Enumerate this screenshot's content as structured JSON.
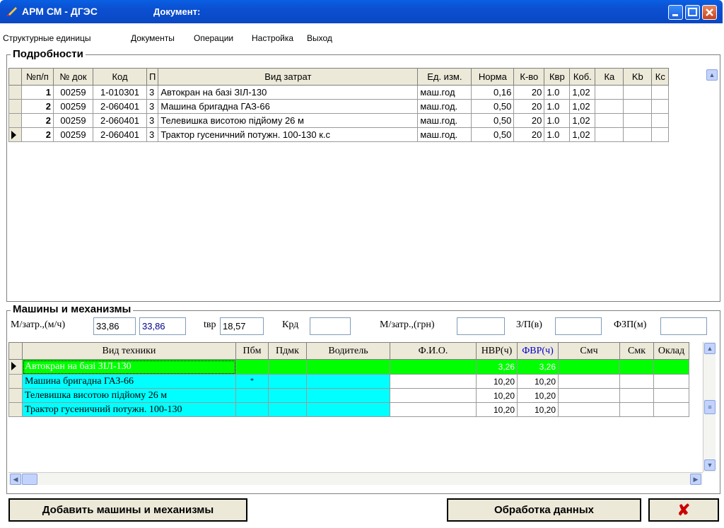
{
  "window": {
    "app_title": "АРМ СМ - ДГЭС",
    "doc_label": "Документ:"
  },
  "menu": [
    "Структурные единицы",
    "Документы",
    "Операции",
    "Настройка",
    "Выход"
  ],
  "details": {
    "label": "Подробности",
    "columns": [
      "№п/п",
      "№ док",
      "Код",
      "П",
      "Вид затрат",
      "Ед. изм.",
      "Норма",
      "К-во",
      "Квр",
      "Коб.",
      "Ка",
      "Kb",
      "Кс"
    ],
    "rows": [
      [
        "1",
        "00259",
        "1-010301",
        "3",
        "Автокран на базі ЗІЛ-130",
        "маш.год",
        "0,16",
        "20",
        "1.0",
        "1,02",
        "",
        "",
        ""
      ],
      [
        "2",
        "00259",
        "2-060401",
        "3",
        "Машина бригадна ГАЗ-66",
        "маш.год.",
        "0,50",
        "20",
        "1.0",
        "1,02",
        "",
        "",
        ""
      ],
      [
        "2",
        "00259",
        "2-060401",
        "3",
        "Телевишка висотою підйому 26 м",
        "маш.год.",
        "0,50",
        "20",
        "1.0",
        "1,02",
        "",
        "",
        ""
      ],
      [
        "2",
        "00259",
        "2-060401",
        "3",
        "Трактор гусеничний потужн. 100-130 к.с",
        "маш.год.",
        "0,50",
        "20",
        "1.0",
        "1,02",
        "",
        "",
        ""
      ]
    ]
  },
  "machines": {
    "label": "Машины и механизмы",
    "fields": {
      "mzatr_label": "М/затр.,(м/ч)",
      "mzatr_value1": "33,86",
      "mzatr_value2": "33,86",
      "tvr_label": "tвр",
      "tvr_value": "18,57",
      "krd_label": "Крд",
      "krd_value": "",
      "mzatr_grn_label": "М/затр.,(грн)",
      "mzatr_grn_value": "",
      "zp_label": "З/П(в)",
      "zp_value": "",
      "fzp_label": "ФЗП(м)",
      "fzp_value": ""
    },
    "columns": [
      "Вид техники",
      "Пбм",
      "Пдмк",
      "Водитель",
      "Ф.И.О.",
      "НВР(ч)",
      "ФВР(ч)",
      "Смч",
      "Смк",
      "Оклад"
    ],
    "rows": [
      [
        "Автокран на базі ЗІЛ-130",
        "",
        "",
        "",
        "",
        "3,26",
        "3,26",
        "",
        "",
        ""
      ],
      [
        "Машина бригадна ГАЗ-66",
        "*",
        "",
        "",
        "",
        "10,20",
        "10,20",
        "",
        "",
        ""
      ],
      [
        "Телевишка висотою підйому 26 м",
        "",
        "",
        "",
        "",
        "10,20",
        "10,20",
        "",
        "",
        ""
      ],
      [
        "Трактор гусеничний потужн. 100-130",
        "",
        "",
        "",
        "",
        "10,20",
        "10,20",
        "",
        "",
        ""
      ]
    ]
  },
  "buttons": {
    "add": "Добавить машины и механизмы",
    "process": "Обработка данных",
    "close_glyph": "✘"
  },
  "colors": {
    "title": "#0a4fd0",
    "selected_row": "#00ff00",
    "editable_cells": "#00ffff",
    "close_x": "#cc0000"
  }
}
